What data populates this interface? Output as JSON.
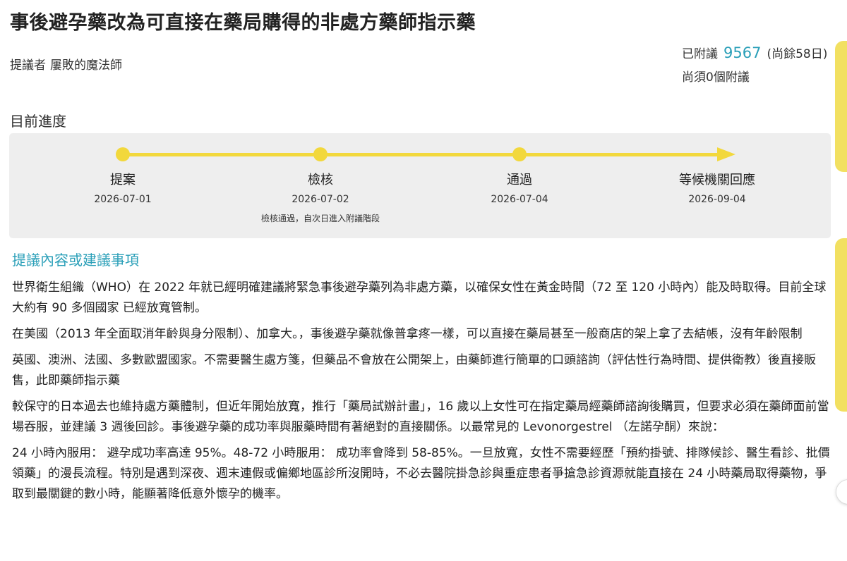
{
  "page": {
    "title": "事後避孕藥改為可直接在藥局購得的非處方藥師指示藥",
    "proposer_label": "提議者",
    "proposer_name": "屢敗的魔法師"
  },
  "sign": {
    "prefix": "已附議",
    "count": "9567",
    "remaining": "(尚餘58日)",
    "needed": "尚須0個附議"
  },
  "progress": {
    "title": "目前進度",
    "stages": [
      {
        "label": "提案",
        "date": "2026-07-01",
        "note": ""
      },
      {
        "label": "檢核",
        "date": "2026-07-02",
        "note": "檢核通過，自次日進入附議階段"
      },
      {
        "label": "通過",
        "date": "2026-07-04",
        "note": ""
      },
      {
        "label": "等候機關回應",
        "date": "2026-09-04",
        "note": ""
      }
    ]
  },
  "content": {
    "heading": "提議內容或建議事項",
    "paragraphs": [
      "世界衛生組織（WHO）在 2022 年就已經明確建議將緊急事後避孕藥列為非處方藥，以確保女性在黃金時間（72 至 120 小時內）能及時取得。目前全球大約有 90 多個國家 已經放寬管制。",
      "在美國（2013 年全面取消年齡與身分限制）、加拿大。，事後避孕藥就像普拿疼一樣，可以直接在藥局甚至一般商店的架上拿了去結帳，沒有年齡限制",
      "英國、澳洲、法國、多數歐盟國家。不需要醫生處方箋，但藥品不會放在公開架上，由藥師進行簡單的口頭諮詢（評估性行為時間、提供衛教）後直接販售，此即藥師指示藥",
      "較保守的日本過去也維持處方藥體制，但近年開始放寬，推行「藥局試辦計畫」，16 歲以上女性可在指定藥局經藥師諮詢後購買，但要求必須在藥師面前當場吞服，並建議 3 週後回診。事後避孕藥的成功率與服藥時間有著絕對的直接關係。以最常見的 Levonorgestrel （左諾孕酮）來說：",
      "24 小時內服用： 避孕成功率高達 95%。48-72 小時服用： 成功率會降到 58-85%。一旦放寬，女性不需要經歷「預約掛號、排隊候診、醫生看診、批價領藥」的漫長流程。特別是遇到深夜、週末連假或偏鄉地區診所沒開時，不必去醫院掛急診與重症患者爭搶急診資源就能直接在 24 小時藥局取得藥物，爭取到最關鍵的數小時，能顯著降低意外懷孕的機率。"
    ]
  },
  "colors": {
    "accent": "#2a9fb8",
    "progress_yellow": "#f2d83c",
    "panel_bg": "#eeeeee",
    "side_tab": "#f2e061"
  }
}
